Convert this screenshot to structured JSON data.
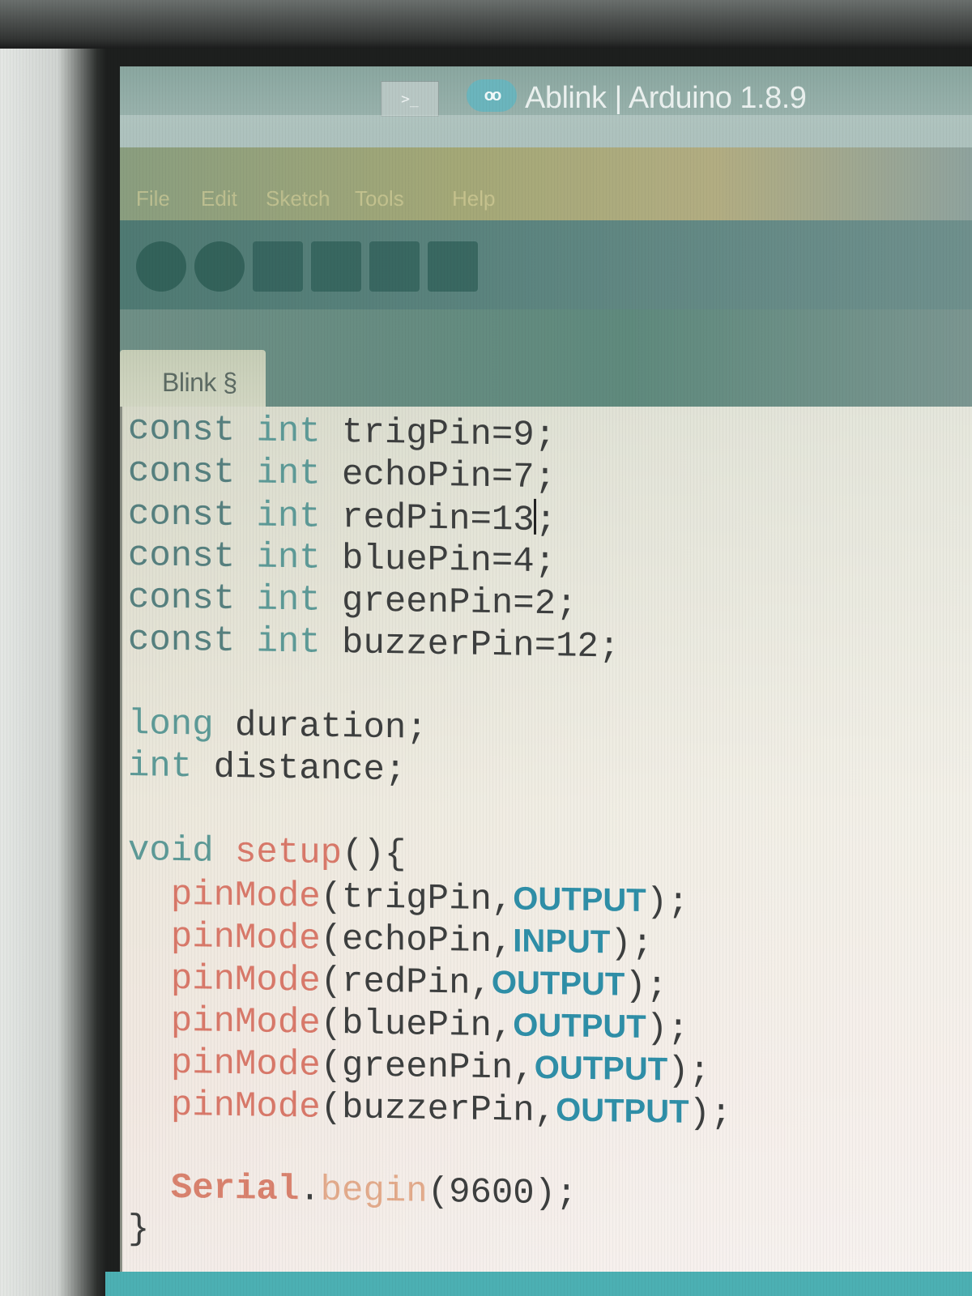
{
  "window": {
    "title": "Ablink | Arduino 1.8.9",
    "terminal_icon": ">_",
    "logo_text": "oo"
  },
  "menu": {
    "items": [
      "File",
      "Edit",
      "Sketch",
      "Tools",
      "Help"
    ]
  },
  "tab": {
    "label": "Blink §"
  },
  "editor": {
    "lines": [
      [
        {
          "t": "const",
          "c": "kw-const"
        },
        {
          "t": " "
        },
        {
          "t": "int",
          "c": "kw-type"
        },
        {
          "t": " trigPin=9;"
        }
      ],
      [
        {
          "t": "const",
          "c": "kw-const"
        },
        {
          "t": " "
        },
        {
          "t": "int",
          "c": "kw-type"
        },
        {
          "t": " echoPin=7;"
        }
      ],
      [
        {
          "t": "const",
          "c": "kw-const"
        },
        {
          "t": " "
        },
        {
          "t": "int",
          "c": "kw-type"
        },
        {
          "t": " redPin=13"
        },
        {
          "t": "|",
          "c": "caret"
        },
        {
          "t": ";"
        }
      ],
      [
        {
          "t": "const",
          "c": "kw-const"
        },
        {
          "t": " "
        },
        {
          "t": "int",
          "c": "kw-type"
        },
        {
          "t": " bluePin=4;"
        }
      ],
      [
        {
          "t": "const",
          "c": "kw-const"
        },
        {
          "t": " "
        },
        {
          "t": "int",
          "c": "kw-type"
        },
        {
          "t": " greenPin=2;"
        }
      ],
      [
        {
          "t": "const",
          "c": "kw-const"
        },
        {
          "t": " "
        },
        {
          "t": "int",
          "c": "kw-type"
        },
        {
          "t": " buzzerPin=12;"
        }
      ],
      [],
      [
        {
          "t": "long",
          "c": "kw-type"
        },
        {
          "t": " duration;"
        }
      ],
      [
        {
          "t": "int",
          "c": "kw-type"
        },
        {
          "t": " distance;"
        }
      ],
      [],
      [
        {
          "t": "void",
          "c": "kw-type"
        },
        {
          "t": " "
        },
        {
          "t": "setup",
          "c": "fn-core"
        },
        {
          "t": "(){"
        }
      ],
      [
        {
          "t": "  "
        },
        {
          "t": "pinMode",
          "c": "fn-core"
        },
        {
          "t": "(trigPin,"
        },
        {
          "t": "OUTPUT",
          "c": "const-pin"
        },
        {
          "t": ");"
        }
      ],
      [
        {
          "t": "  "
        },
        {
          "t": "pinMode",
          "c": "fn-core"
        },
        {
          "t": "(echoPin,"
        },
        {
          "t": "INPUT",
          "c": "const-pin"
        },
        {
          "t": ");"
        }
      ],
      [
        {
          "t": "  "
        },
        {
          "t": "pinMode",
          "c": "fn-core"
        },
        {
          "t": "(redPin,"
        },
        {
          "t": "OUTPUT",
          "c": "const-pin"
        },
        {
          "t": ");"
        }
      ],
      [
        {
          "t": "  "
        },
        {
          "t": "pinMode",
          "c": "fn-core"
        },
        {
          "t": "(bluePin,"
        },
        {
          "t": "OUTPUT",
          "c": "const-pin"
        },
        {
          "t": ");"
        }
      ],
      [
        {
          "t": "  "
        },
        {
          "t": "pinMode",
          "c": "fn-core"
        },
        {
          "t": "(greenPin,"
        },
        {
          "t": "OUTPUT",
          "c": "const-pin"
        },
        {
          "t": ");"
        }
      ],
      [
        {
          "t": "  "
        },
        {
          "t": "pinMode",
          "c": "fn-core"
        },
        {
          "t": "(buzzerPin,"
        },
        {
          "t": "OUTPUT",
          "c": "const-pin"
        },
        {
          "t": ");"
        }
      ],
      [],
      [
        {
          "t": "  "
        },
        {
          "t": "Serial",
          "c": "kw-obj"
        },
        {
          "t": "."
        },
        {
          "t": "begin",
          "c": "fn-lib"
        },
        {
          "t": "(9600);"
        }
      ],
      [
        {
          "t": "}"
        }
      ]
    ]
  },
  "colors": {
    "status_strip": "#4cb0b3",
    "editor_bg": "#ece8dc"
  }
}
